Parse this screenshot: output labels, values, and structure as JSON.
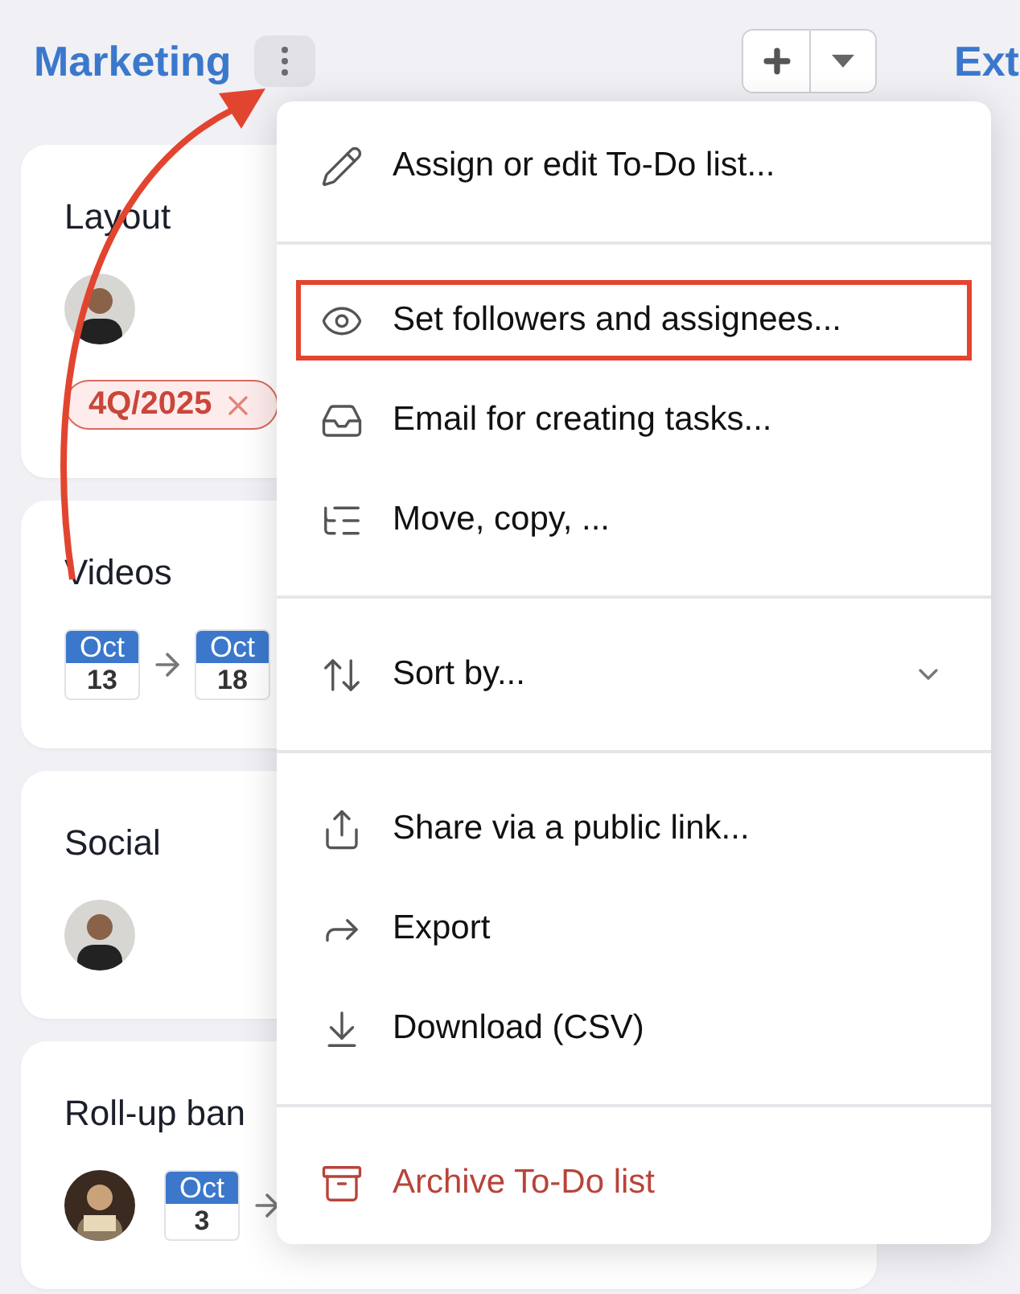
{
  "columns": [
    {
      "title": "Marketing",
      "cards": [
        {
          "title": "Layout",
          "avatar": true,
          "tag": {
            "label": "4Q/2025"
          }
        },
        {
          "title": "Videos",
          "avatar": false,
          "dates": [
            {
              "month": "Oct",
              "day": "13"
            },
            {
              "month": "Oct",
              "day": "18"
            }
          ]
        },
        {
          "title": "Social",
          "avatar": true
        },
        {
          "title": "Roll-up ban",
          "avatar": true,
          "dates": [
            {
              "month": "Oct",
              "day": "3"
            }
          ],
          "range_continues": true
        }
      ]
    },
    {
      "title": "Ext"
    }
  ],
  "menu": {
    "sections": [
      [
        {
          "label": "Assign or edit To-Do list...",
          "kind": "action",
          "highlighted": false
        }
      ],
      [
        {
          "label": "Set followers and assignees...",
          "kind": "action",
          "highlighted": true
        },
        {
          "label": "Email for creating tasks...",
          "kind": "action",
          "highlighted": false
        },
        {
          "label": "Move, copy, ...",
          "kind": "action",
          "highlighted": false
        }
      ],
      [
        {
          "label": "Sort by...",
          "kind": "submenu",
          "highlighted": false
        }
      ],
      [
        {
          "label": "Share via a public link...",
          "kind": "action",
          "highlighted": false
        },
        {
          "label": "Export",
          "kind": "action",
          "highlighted": false
        },
        {
          "label": "Download (CSV)",
          "kind": "action",
          "highlighted": false
        }
      ],
      [
        {
          "label": "Archive To-Do list",
          "kind": "danger",
          "highlighted": false
        }
      ]
    ]
  }
}
